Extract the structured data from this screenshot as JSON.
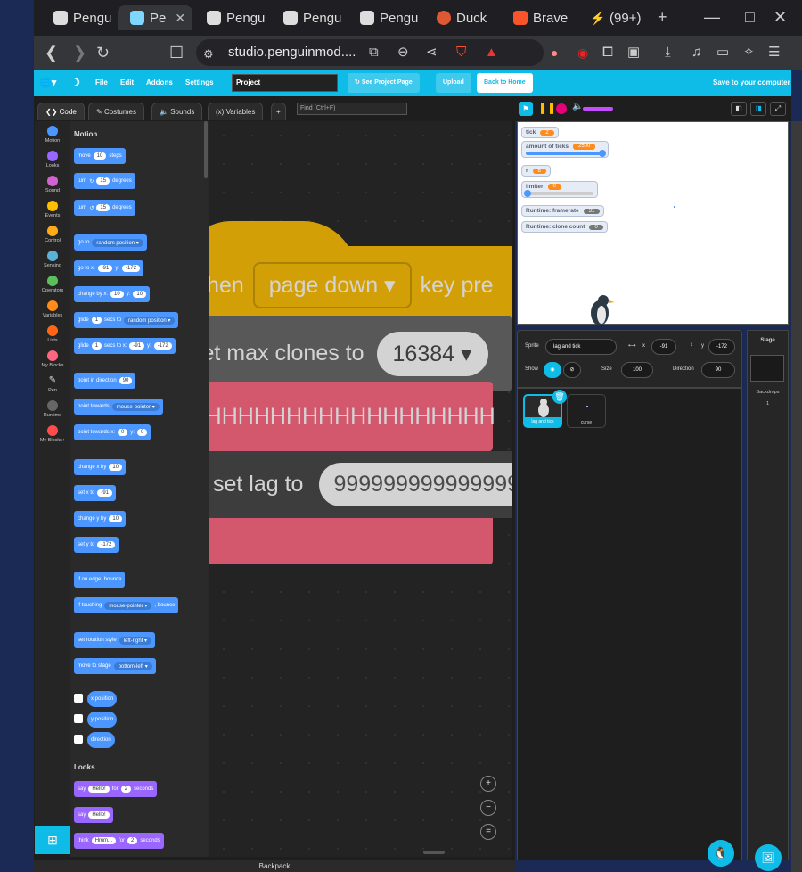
{
  "browser": {
    "tabs": [
      {
        "label": "Pengu"
      },
      {
        "label": "Pe"
      },
      {
        "label": "Pengu"
      },
      {
        "label": "Pengu"
      },
      {
        "label": "Pengu"
      },
      {
        "label": "Duck"
      },
      {
        "label": "Brave"
      },
      {
        "label": "(99+)"
      }
    ],
    "url": "studio.penguinmod...."
  },
  "menubar": {
    "file": "File",
    "edit": "Edit",
    "addons": "Addons",
    "settings": "Settings",
    "project_title": "Project",
    "see_project": "See Project Page",
    "upload": "Upload",
    "back_home": "Back to Home",
    "save": "Save to your computer"
  },
  "editor_tabs": {
    "code": "Code",
    "costumes": "Costumes",
    "sounds": "Sounds",
    "variables": "Variables",
    "find_placeholder": "Find (Ctrl+F)"
  },
  "categories": [
    {
      "label": "Motion",
      "color": "#4c97ff"
    },
    {
      "label": "Looks",
      "color": "#9966ff"
    },
    {
      "label": "Sound",
      "color": "#cf63cf"
    },
    {
      "label": "Events",
      "color": "#ffbf00"
    },
    {
      "label": "Control",
      "color": "#ffab19"
    },
    {
      "label": "Sensing",
      "color": "#5cb1d6"
    },
    {
      "label": "Operators",
      "color": "#59c059"
    },
    {
      "label": "Variables",
      "color": "#ff8c1a"
    },
    {
      "label": "Lists",
      "color": "#ff661a"
    },
    {
      "label": "My Blocks",
      "color": "#ff6680"
    },
    {
      "label": "Pen",
      "color": "#0fbd8c"
    },
    {
      "label": "Runtime",
      "color": "#666666"
    },
    {
      "label": "My Blocks+",
      "color": "#ff4c4c"
    }
  ],
  "palette": {
    "motion_heading": "Motion",
    "looks_heading": "Looks",
    "move": {
      "a": "move",
      "n": "10",
      "b": "steps"
    },
    "turn_cw": {
      "a": "turn",
      "n": "15",
      "b": "degrees"
    },
    "turn_ccw": {
      "a": "turn",
      "n": "15",
      "b": "degrees"
    },
    "goto": {
      "a": "go to",
      "d": "random position"
    },
    "gotoxy": {
      "a": "go to x:",
      "x": "-91",
      "b": "y:",
      "y": "-172"
    },
    "changeby": {
      "a": "change by x:",
      "x": "10",
      "b": "y:",
      "y": "10"
    },
    "glide1": {
      "a": "glide",
      "n": "1",
      "b": "secs to",
      "d": "random position"
    },
    "glide2": {
      "a": "glide",
      "n": "1",
      "b": "secs to x:",
      "x": "-91",
      "c": "y:",
      "y": "-172"
    },
    "point": {
      "a": "point in direction",
      "n": "90"
    },
    "pointtowards": {
      "a": "point towards",
      "d": "mouse-pointer"
    },
    "pointtowardsxy": {
      "a": "point towards x:",
      "x": "0",
      "b": "y:",
      "y": "0"
    },
    "changex": {
      "a": "change x by",
      "n": "10"
    },
    "setx": {
      "a": "set x to",
      "n": "-91"
    },
    "changey": {
      "a": "change y by",
      "n": "10"
    },
    "sety": {
      "a": "set y to",
      "n": "-172"
    },
    "bounce": {
      "a": "if on edge, bounce"
    },
    "iftouching": {
      "a": "if touching",
      "d": "mouse-pointer",
      "b": ", bounce"
    },
    "rotation": {
      "a": "set rotation style",
      "d": "left-right"
    },
    "movestage": {
      "a": "move to stage",
      "d": "bottom-left"
    },
    "xpos": "x position",
    "ypos": "y position",
    "dir": "direction",
    "sayfor": {
      "a": "say",
      "t": "Hello!",
      "b": "for",
      "n": "2",
      "c": "seconds"
    },
    "say": {
      "a": "say",
      "t": "Hello!"
    },
    "think": {
      "a": "think",
      "t": "Hmm...",
      "b": "for",
      "n": "2",
      "c": "seconds"
    }
  },
  "script": {
    "hat_a": "when",
    "hat_key": "page down",
    "hat_b": "key pre",
    "maxclones_a": "set max clones to",
    "maxclones_v": "16384",
    "custom": "AHHHHHHHHHHHHHHHHHH",
    "setlag_a": "set lag to",
    "setlag_v": "999999999999999"
  },
  "monitors": [
    {
      "label": "tick",
      "value": "2"
    },
    {
      "label": "amount of ticks",
      "value": "2500",
      "slider": 1.0
    },
    {
      "label": "r",
      "value": "8"
    },
    {
      "label": "limiter",
      "value": "0",
      "slider": 0.0
    },
    {
      "label": "Runtime: framerate",
      "value": "31"
    },
    {
      "label": "Runtime: clone count",
      "value": "0"
    }
  ],
  "sprite_info": {
    "sprite_label": "Sprite",
    "sprite_name": "lag and tick",
    "x_label": "x",
    "x": "-91",
    "y_label": "y",
    "y": "-172",
    "show_label": "Show",
    "size_label": "Size",
    "size": "100",
    "direction_label": "Direction",
    "direction": "90"
  },
  "sprites": [
    {
      "name": "lag and tick"
    },
    {
      "name": "curse"
    }
  ],
  "stage_panel": {
    "label": "Stage",
    "backdrops_label": "Backdrops",
    "backdrops": "1"
  },
  "backpack": "Backpack"
}
